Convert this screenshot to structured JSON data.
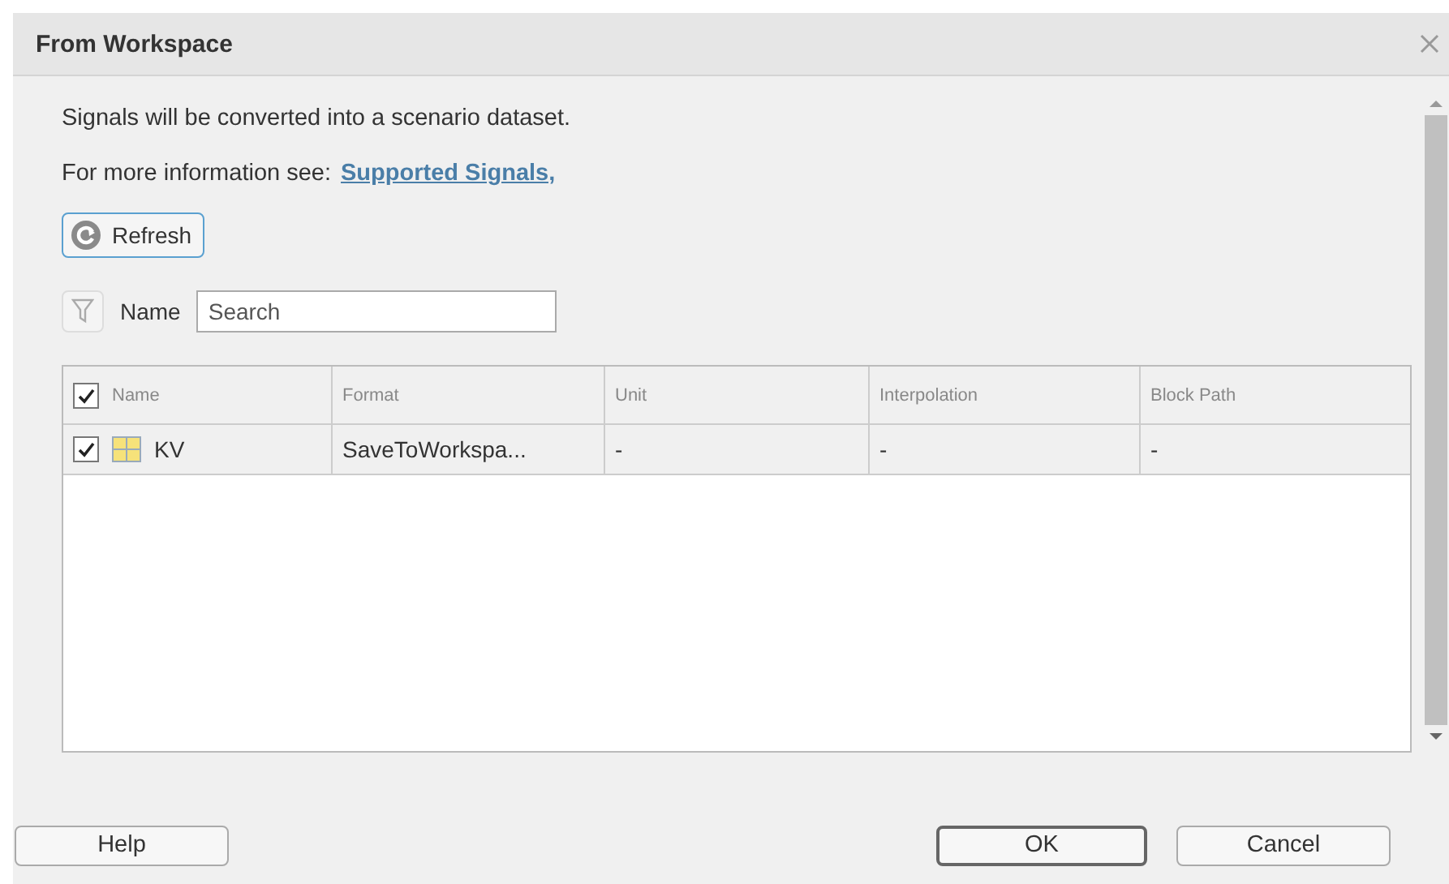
{
  "window": {
    "title": "From Workspace"
  },
  "description": "Signals will be converted into a scenario dataset.",
  "info": {
    "text": "For more information see:",
    "link": "Supported Signals,"
  },
  "refresh_button": "Refresh",
  "filter": {
    "label": "Name",
    "placeholder": "Search"
  },
  "table": {
    "all_checked": true,
    "columns": [
      "Name",
      "Format",
      "Unit",
      "Interpolation",
      "Block Path"
    ],
    "rows": [
      {
        "checked": true,
        "cells": [
          "KV",
          "SaveToWorkspa...",
          "-",
          "-",
          "-"
        ]
      }
    ]
  },
  "buttons": [
    {
      "label": "Help",
      "kind": "left"
    },
    {
      "label": "OK",
      "kind": "default"
    },
    {
      "label": "Cancel",
      "kind": "right"
    }
  ]
}
